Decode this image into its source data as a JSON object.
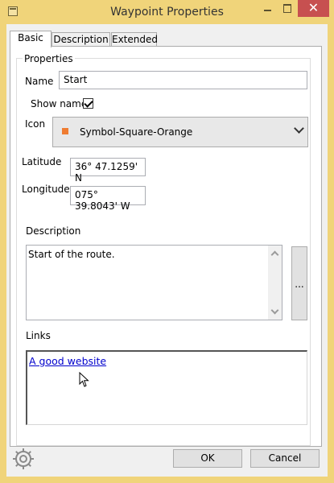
{
  "window": {
    "title": "Waypoint Properties",
    "close_glyph": "✕"
  },
  "tabs": [
    {
      "label": "Basic",
      "active": true
    },
    {
      "label": "Description",
      "active": false
    },
    {
      "label": "Extended",
      "active": false
    }
  ],
  "properties": {
    "group_title": "Properties",
    "name_label": "Name",
    "name_value": "Start",
    "show_name_label": "Show name",
    "show_name_checked": true,
    "icon_label": "Icon",
    "icon_value": "Symbol-Square-Orange",
    "icon_symbol_color": "#ef7c32",
    "latitude_label": "Latitude",
    "latitude_value": "36° 47.1259' N",
    "longitude_label": "Longitude",
    "longitude_value": "075° 39.8043' W",
    "description_label": "Description",
    "description_value": "Start of the route.",
    "description_button": "...",
    "links_label": "Links",
    "links": [
      "A good website"
    ]
  },
  "footer": {
    "ok_label": "OK",
    "cancel_label": "Cancel",
    "settings_icon": "gear-icon"
  },
  "colors": {
    "title_bar": "#f0d47a",
    "close_button": "#c75050",
    "link": "#0000cc"
  }
}
